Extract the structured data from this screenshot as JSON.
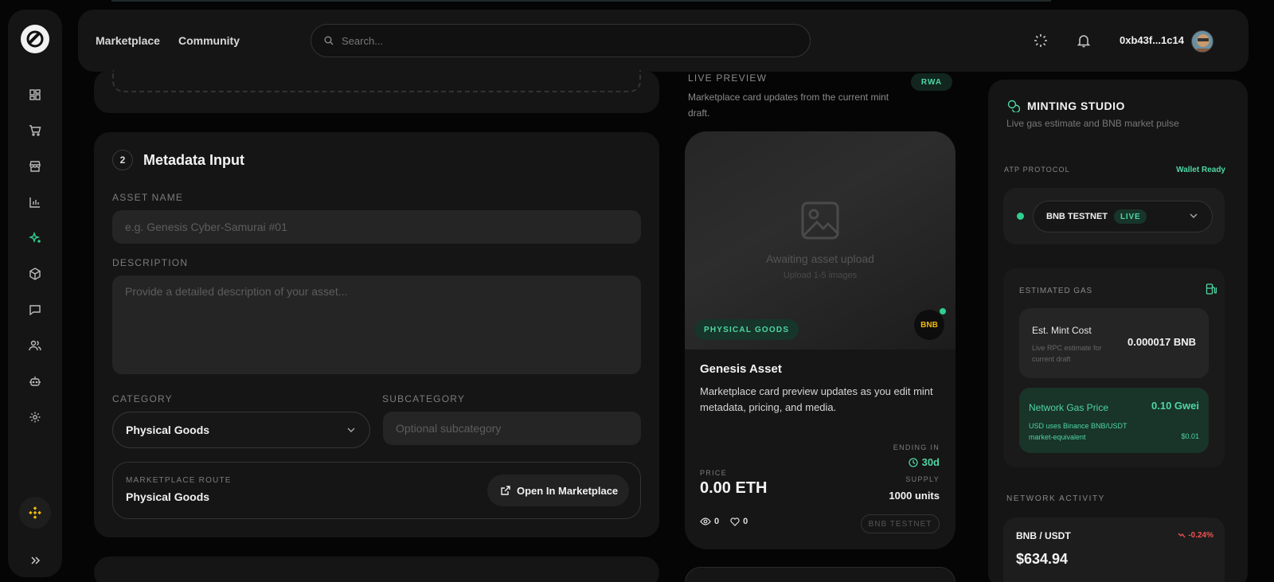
{
  "topbar": {
    "nav": [
      "Marketplace",
      "Community"
    ],
    "search_placeholder": "Search...",
    "wallet": "0xb43f...1c14"
  },
  "sidebar": {
    "icons": [
      "dashboard-icon",
      "cart-icon",
      "store-icon",
      "chart-icon",
      "sparkles-icon",
      "cube-icon",
      "chat-icon",
      "users-icon",
      "bot-icon",
      "gear-icon"
    ],
    "active": "sparkles-icon"
  },
  "form": {
    "step_number": "2",
    "title": "Metadata Input",
    "asset_name_label": "ASSET NAME",
    "asset_name_placeholder": "e.g. Genesis Cyber-Samurai #01",
    "description_label": "DESCRIPTION",
    "description_placeholder": "Provide a detailed description of your asset...",
    "category_label": "CATEGORY",
    "category_value": "Physical Goods",
    "subcategory_label": "SUBCATEGORY",
    "subcategory_placeholder": "Optional subcategory",
    "route_label": "MARKETPLACE ROUTE",
    "route_value": "Physical Goods",
    "open_button": "Open In Marketplace"
  },
  "preview": {
    "label": "LIVE PREVIEW",
    "subtitle": "Marketplace card updates from the current mint draft.",
    "badge": "RWA",
    "awaiting": "Awaiting asset upload",
    "upload_hint": "Upload 1-5 images",
    "category_tag": "PHYSICAL GOODS",
    "chain_badge": "BNB",
    "title": "Genesis Asset",
    "description": "Marketplace card preview updates as you edit mint metadata, pricing, and media.",
    "ending_label": "ENDING IN",
    "ending_value": "30d",
    "price_label": "PRICE",
    "price_value": "0.00 ETH",
    "supply_label": "SUPPLY",
    "supply_value": "1000 units",
    "views": "0",
    "likes": "0",
    "network_tag": "BNB TESTNET"
  },
  "studio": {
    "title": "MINTING STUDIO",
    "subtitle": "Live gas estimate and BNB market pulse",
    "protocol_label": "ATP PROTOCOL",
    "wallet_status": "Wallet Ready",
    "network": "BNB TESTNET",
    "network_status": "LIVE",
    "gas_label": "ESTIMATED GAS",
    "mint_cost_title": "Est. Mint Cost",
    "mint_cost_sub": "Live RPC estimate for current draft",
    "mint_cost_value": "0.000017 BNB",
    "gas_price_title": "Network Gas Price",
    "gas_price_sub": "USD uses Binance BNB/USDT market-equivalent",
    "gas_price_value": "0.10 Gwei",
    "gas_price_usd": "$0.01",
    "activity_label": "NETWORK ACTIVITY",
    "pair": "BNB / USDT",
    "pair_change": "-0.24%",
    "pair_price": "$634.94"
  },
  "colors": {
    "accent": "#4fd6a4",
    "negative": "#ef5350",
    "bnb": "#f0b90b"
  }
}
